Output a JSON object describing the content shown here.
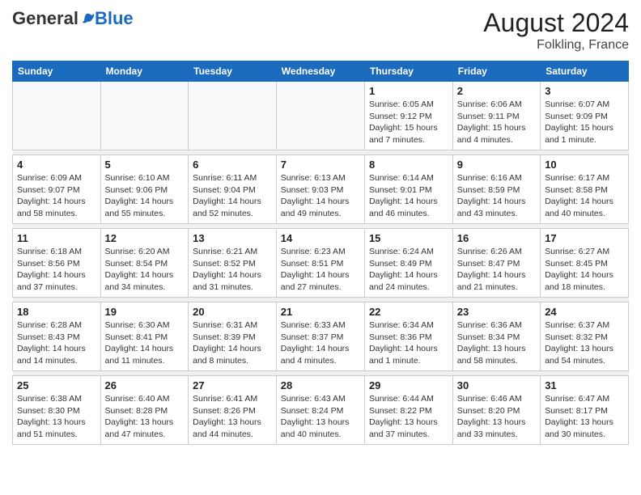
{
  "header": {
    "logo_general": "General",
    "logo_blue": "Blue",
    "month_year": "August 2024",
    "location": "Folkling, France"
  },
  "weekdays": [
    "Sunday",
    "Monday",
    "Tuesday",
    "Wednesday",
    "Thursday",
    "Friday",
    "Saturday"
  ],
  "weeks": [
    [
      {
        "day": "",
        "info": ""
      },
      {
        "day": "",
        "info": ""
      },
      {
        "day": "",
        "info": ""
      },
      {
        "day": "",
        "info": ""
      },
      {
        "day": "1",
        "info": "Sunrise: 6:05 AM\nSunset: 9:12 PM\nDaylight: 15 hours\nand 7 minutes."
      },
      {
        "day": "2",
        "info": "Sunrise: 6:06 AM\nSunset: 9:11 PM\nDaylight: 15 hours\nand 4 minutes."
      },
      {
        "day": "3",
        "info": "Sunrise: 6:07 AM\nSunset: 9:09 PM\nDaylight: 15 hours\nand 1 minute."
      }
    ],
    [
      {
        "day": "4",
        "info": "Sunrise: 6:09 AM\nSunset: 9:07 PM\nDaylight: 14 hours\nand 58 minutes."
      },
      {
        "day": "5",
        "info": "Sunrise: 6:10 AM\nSunset: 9:06 PM\nDaylight: 14 hours\nand 55 minutes."
      },
      {
        "day": "6",
        "info": "Sunrise: 6:11 AM\nSunset: 9:04 PM\nDaylight: 14 hours\nand 52 minutes."
      },
      {
        "day": "7",
        "info": "Sunrise: 6:13 AM\nSunset: 9:03 PM\nDaylight: 14 hours\nand 49 minutes."
      },
      {
        "day": "8",
        "info": "Sunrise: 6:14 AM\nSunset: 9:01 PM\nDaylight: 14 hours\nand 46 minutes."
      },
      {
        "day": "9",
        "info": "Sunrise: 6:16 AM\nSunset: 8:59 PM\nDaylight: 14 hours\nand 43 minutes."
      },
      {
        "day": "10",
        "info": "Sunrise: 6:17 AM\nSunset: 8:58 PM\nDaylight: 14 hours\nand 40 minutes."
      }
    ],
    [
      {
        "day": "11",
        "info": "Sunrise: 6:18 AM\nSunset: 8:56 PM\nDaylight: 14 hours\nand 37 minutes."
      },
      {
        "day": "12",
        "info": "Sunrise: 6:20 AM\nSunset: 8:54 PM\nDaylight: 14 hours\nand 34 minutes."
      },
      {
        "day": "13",
        "info": "Sunrise: 6:21 AM\nSunset: 8:52 PM\nDaylight: 14 hours\nand 31 minutes."
      },
      {
        "day": "14",
        "info": "Sunrise: 6:23 AM\nSunset: 8:51 PM\nDaylight: 14 hours\nand 27 minutes."
      },
      {
        "day": "15",
        "info": "Sunrise: 6:24 AM\nSunset: 8:49 PM\nDaylight: 14 hours\nand 24 minutes."
      },
      {
        "day": "16",
        "info": "Sunrise: 6:26 AM\nSunset: 8:47 PM\nDaylight: 14 hours\nand 21 minutes."
      },
      {
        "day": "17",
        "info": "Sunrise: 6:27 AM\nSunset: 8:45 PM\nDaylight: 14 hours\nand 18 minutes."
      }
    ],
    [
      {
        "day": "18",
        "info": "Sunrise: 6:28 AM\nSunset: 8:43 PM\nDaylight: 14 hours\nand 14 minutes."
      },
      {
        "day": "19",
        "info": "Sunrise: 6:30 AM\nSunset: 8:41 PM\nDaylight: 14 hours\nand 11 minutes."
      },
      {
        "day": "20",
        "info": "Sunrise: 6:31 AM\nSunset: 8:39 PM\nDaylight: 14 hours\nand 8 minutes."
      },
      {
        "day": "21",
        "info": "Sunrise: 6:33 AM\nSunset: 8:37 PM\nDaylight: 14 hours\nand 4 minutes."
      },
      {
        "day": "22",
        "info": "Sunrise: 6:34 AM\nSunset: 8:36 PM\nDaylight: 14 hours\nand 1 minute."
      },
      {
        "day": "23",
        "info": "Sunrise: 6:36 AM\nSunset: 8:34 PM\nDaylight: 13 hours\nand 58 minutes."
      },
      {
        "day": "24",
        "info": "Sunrise: 6:37 AM\nSunset: 8:32 PM\nDaylight: 13 hours\nand 54 minutes."
      }
    ],
    [
      {
        "day": "25",
        "info": "Sunrise: 6:38 AM\nSunset: 8:30 PM\nDaylight: 13 hours\nand 51 minutes."
      },
      {
        "day": "26",
        "info": "Sunrise: 6:40 AM\nSunset: 8:28 PM\nDaylight: 13 hours\nand 47 minutes."
      },
      {
        "day": "27",
        "info": "Sunrise: 6:41 AM\nSunset: 8:26 PM\nDaylight: 13 hours\nand 44 minutes."
      },
      {
        "day": "28",
        "info": "Sunrise: 6:43 AM\nSunset: 8:24 PM\nDaylight: 13 hours\nand 40 minutes."
      },
      {
        "day": "29",
        "info": "Sunrise: 6:44 AM\nSunset: 8:22 PM\nDaylight: 13 hours\nand 37 minutes."
      },
      {
        "day": "30",
        "info": "Sunrise: 6:46 AM\nSunset: 8:20 PM\nDaylight: 13 hours\nand 33 minutes."
      },
      {
        "day": "31",
        "info": "Sunrise: 6:47 AM\nSunset: 8:17 PM\nDaylight: 13 hours\nand 30 minutes."
      }
    ]
  ]
}
